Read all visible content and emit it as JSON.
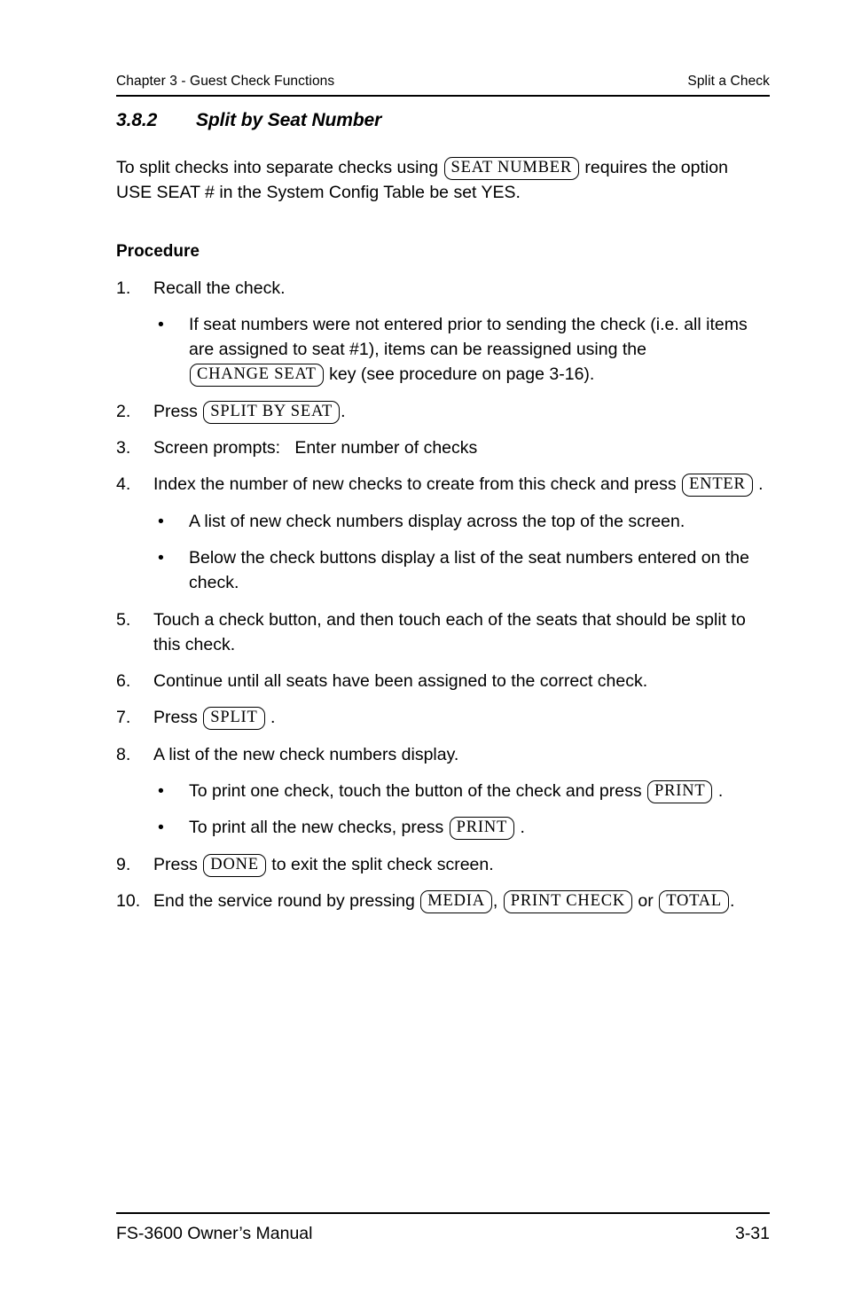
{
  "header": {
    "left": "Chapter 3 - Guest Check Functions",
    "right": "Split a Check"
  },
  "section": {
    "number": "3.8.2",
    "title": "Split by Seat Number"
  },
  "intro": {
    "part1": "To split checks into separate checks using",
    "key": "SEAT NUMBER",
    "part2": "requires the option USE SEAT # in the System Config Table be set YES."
  },
  "procedure": {
    "heading": "Procedure"
  },
  "steps": {
    "s1": {
      "marker": "1.",
      "text": "Recall the check."
    },
    "s1b1": {
      "dot": "•",
      "part1": "If seat numbers were not entered prior to sending the check (i.e. all items are assigned to seat #1), items can be reassigned using the",
      "key": "CHANGE SEAT",
      "part2": "key (see procedure on page 3-16)."
    },
    "s2": {
      "marker": "2.",
      "part1": "Press",
      "key": "SPLIT BY SEAT",
      "part2": "."
    },
    "s3": {
      "marker": "3.",
      "label": "Screen prompts:",
      "prompt": "Enter number of checks"
    },
    "s4": {
      "marker": "4.",
      "part1": "Index the number of new checks to create from this check and press",
      "key": "ENTER",
      "part2": "."
    },
    "s4b1": {
      "dot": "•",
      "text": "A list of new check numbers display across the top of the screen."
    },
    "s4b2": {
      "dot": "•",
      "text": "Below the check buttons display a list of the seat numbers entered on the check."
    },
    "s5": {
      "marker": "5.",
      "text": "Touch a check button, and then touch each of the seats that should be split to this check."
    },
    "s6": {
      "marker": "6.",
      "text": "Continue until all seats have been assigned to the correct check."
    },
    "s7": {
      "marker": "7.",
      "part1": "Press",
      "key": "SPLIT",
      "part2": "."
    },
    "s8": {
      "marker": "8.",
      "text": "A list of the new check numbers display."
    },
    "s8b1": {
      "dot": "•",
      "part1": "To print one check, touch the button of the check and press",
      "key": "PRINT",
      "part2": "."
    },
    "s8b2": {
      "dot": "•",
      "part1": "To print all the new checks, press",
      "key": "PRINT",
      "part2": "."
    },
    "s9": {
      "marker": "9.",
      "part1": "Press",
      "key": "DONE",
      "part2": "to exit the split check screen."
    },
    "s10": {
      "marker": "10.",
      "part1": "End the service round by pressing",
      "key1": "MEDIA",
      "comma": ",",
      "key2": "PRINT CHECK",
      "part2": "or",
      "key3": "TOTAL",
      "part3": "."
    }
  },
  "footer": {
    "left": "FS-3600 Owner’s Manual",
    "right": "3-31"
  }
}
